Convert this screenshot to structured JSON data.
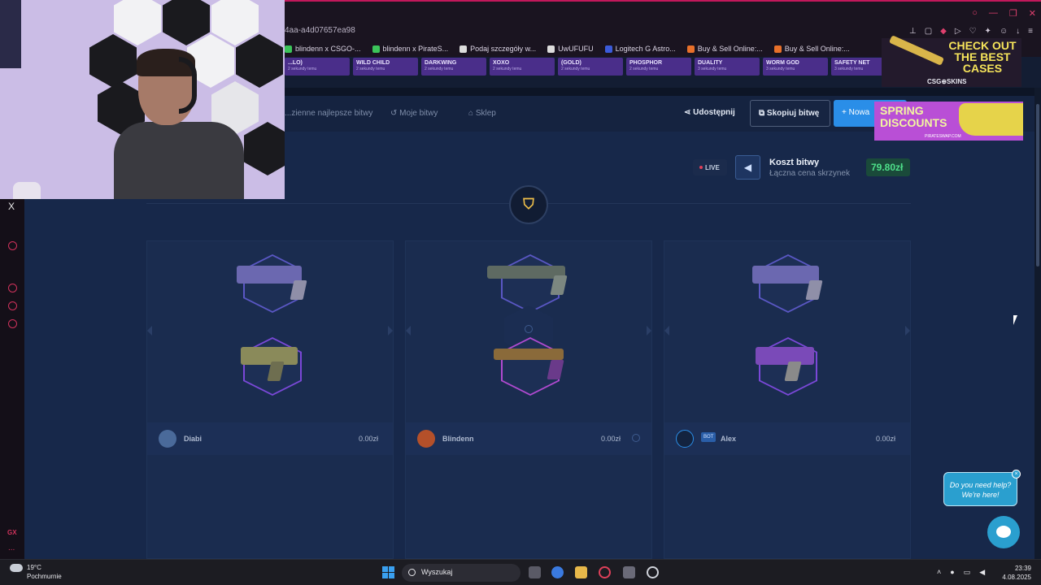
{
  "browser": {
    "url": "4aa-a4d07657ea98",
    "bookmarks": [
      {
        "label": "blindenn x CSGO-...",
        "color": "#3cc45a"
      },
      {
        "label": "blindenn x PirateS...",
        "color": "#3cc45a"
      },
      {
        "label": "Podaj szczegóły w...",
        "color": "#dddddd"
      },
      {
        "label": "UwUFUFU",
        "color": "#dddddd"
      },
      {
        "label": "Logitech G Astro...",
        "color": "#3b5bd9"
      },
      {
        "label": "Buy & Sell Online:...",
        "color": "#e8702a"
      },
      {
        "label": "Buy & Sell Online:...",
        "color": "#e8702a"
      }
    ]
  },
  "ticker": [
    {
      "name": "...LO)",
      "time": "2 sekundy temu"
    },
    {
      "name": "WILD CHILD",
      "time": "2 sekundy temu"
    },
    {
      "name": "DARKWING",
      "time": "2 sekundy temu"
    },
    {
      "name": "XOXO",
      "time": "2 sekundy temu"
    },
    {
      "name": "(GOLD)",
      "time": "2 sekundy temu"
    },
    {
      "name": "PHOSPHOR",
      "time": "2 sekundy temu"
    },
    {
      "name": "DUALITY",
      "time": "3 sekundy temu"
    },
    {
      "name": "WORM GOD",
      "time": "3 sekundy temu"
    },
    {
      "name": "SAFETY NET",
      "time": "3 sekundy temu"
    }
  ],
  "nav": {
    "best_battles": "...zienne najlepsze bitwy",
    "my_battles": "Moje bitwy",
    "shop": "Sklep",
    "share": "Udostępnij",
    "copy_battle": "Skopiuj bitwę",
    "new_battle": "+ Nowa"
  },
  "battle": {
    "live": "LIVE",
    "cost_title": "Koszt bitwy",
    "cost_sub": "Łączna cena skrzynek",
    "cost_value": "79.80zł",
    "players": [
      {
        "name": "Diabi",
        "value": "0.00zł",
        "bot": false
      },
      {
        "name": "Blindenn",
        "value": "0.00zł",
        "bot": false
      },
      {
        "name": "Alex",
        "value": "0.00zł",
        "bot": true,
        "bot_label": "BOT"
      }
    ]
  },
  "ads": {
    "ad1_line": "CHECK OUT THE BEST CASES",
    "ad1_brand": "CSG⊕SKINS",
    "ad2_line": "SPRING DISCOUNTS",
    "ad2_brand": "PIRATESWAP.COM"
  },
  "help": {
    "text": "Do you need help? We're here!",
    "close": "×"
  },
  "taskbar": {
    "temp": "19°C",
    "condition": "Pochmurnie",
    "search": "Wyszukaj",
    "time": "23:39",
    "date": "4.08.2025"
  },
  "sidebar": {
    "x_label": "X",
    "gx_label": "GX",
    "more_label": "..."
  }
}
